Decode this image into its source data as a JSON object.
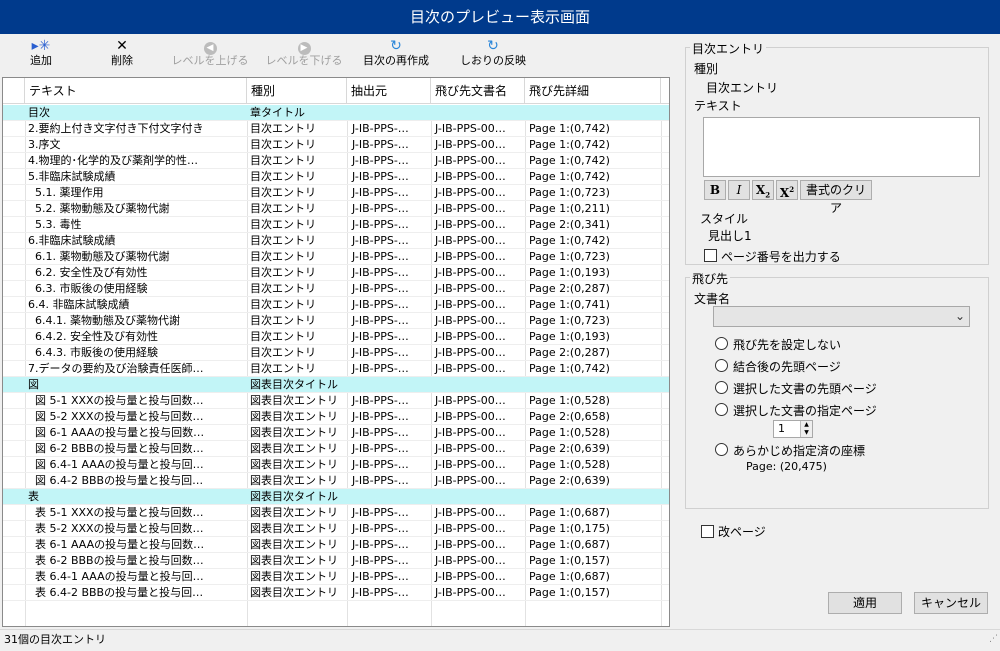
{
  "window": {
    "title": "目次のプレビュー表示画面"
  },
  "toolbar": {
    "add": "追加",
    "delete": "削除",
    "level_up": "レベルを上げる",
    "level_down": "レベルを下げる",
    "regenerate": "目次の再作成",
    "bookmark": "しおりの反映"
  },
  "grid": {
    "headers": [
      "テキスト",
      "種別",
      "抽出元",
      "飛び先文書名",
      "飛び先詳細"
    ],
    "rows": [
      [
        "目次",
        "章タイトル",
        "",
        "",
        ""
      ],
      [
        "2.要約上付き文字付き下付文字付き",
        "目次エントリ",
        "J-IB-PPS-…",
        "J-IB-PPS-00…",
        "Page 1:(0,742)"
      ],
      [
        "3.序文",
        "目次エントリ",
        "J-IB-PPS-…",
        "J-IB-PPS-00…",
        "Page 1:(0,742)"
      ],
      [
        "4.物理的･化学的及び薬剤学的性…",
        "目次エントリ",
        "J-IB-PPS-…",
        "J-IB-PPS-00…",
        "Page 1:(0,742)"
      ],
      [
        "5.非臨床試験成績",
        "目次エントリ",
        "J-IB-PPS-…",
        "J-IB-PPS-00…",
        "Page 1:(0,742)"
      ],
      [
        "  5.1. 薬理作用",
        "目次エントリ",
        "J-IB-PPS-…",
        "J-IB-PPS-00…",
        "Page 1:(0,723)"
      ],
      [
        "  5.2. 薬物動態及び薬物代謝",
        "目次エントリ",
        "J-IB-PPS-…",
        "J-IB-PPS-00…",
        "Page 1:(0,211)"
      ],
      [
        "  5.3. 毒性",
        "目次エントリ",
        "J-IB-PPS-…",
        "J-IB-PPS-00…",
        "Page 2:(0,341)"
      ],
      [
        "6.非臨床試験成績",
        "目次エントリ",
        "J-IB-PPS-…",
        "J-IB-PPS-00…",
        "Page 1:(0,742)"
      ],
      [
        "  6.1. 薬物動態及び薬物代謝",
        "目次エントリ",
        "J-IB-PPS-…",
        "J-IB-PPS-00…",
        "Page 1:(0,723)"
      ],
      [
        "  6.2. 安全性及び有効性",
        "目次エントリ",
        "J-IB-PPS-…",
        "J-IB-PPS-00…",
        "Page 1:(0,193)"
      ],
      [
        "  6.3. 市販後の使用経験",
        "目次エントリ",
        "J-IB-PPS-…",
        "J-IB-PPS-00…",
        "Page 2:(0,287)"
      ],
      [
        "6.4. 非臨床試験成績",
        "目次エントリ",
        "J-IB-PPS-…",
        "J-IB-PPS-00…",
        "Page 1:(0,741)"
      ],
      [
        "  6.4.1. 薬物動態及び薬物代謝",
        "目次エントリ",
        "J-IB-PPS-…",
        "J-IB-PPS-00…",
        "Page 1:(0,723)"
      ],
      [
        "  6.4.2. 安全性及び有効性",
        "目次エントリ",
        "J-IB-PPS-…",
        "J-IB-PPS-00…",
        "Page 1:(0,193)"
      ],
      [
        "  6.4.3. 市販後の使用経験",
        "目次エントリ",
        "J-IB-PPS-…",
        "J-IB-PPS-00…",
        "Page 2:(0,287)"
      ],
      [
        "7.データの要約及び治験責任医師…",
        "目次エントリ",
        "J-IB-PPS-…",
        "J-IB-PPS-00…",
        "Page 1:(0,742)"
      ],
      [
        "図",
        "図表目次タイトル",
        "",
        "",
        ""
      ],
      [
        "  図 5-1 XXXの投与量と投与回数…",
        "図表目次エントリ",
        "J-IB-PPS-…",
        "J-IB-PPS-00…",
        "Page 1:(0,528)"
      ],
      [
        "  図 5-2 XXXの投与量と投与回数…",
        "図表目次エントリ",
        "J-IB-PPS-…",
        "J-IB-PPS-00…",
        "Page 2:(0,658)"
      ],
      [
        "  図 6-1 AAAの投与量と投与回数…",
        "図表目次エントリ",
        "J-IB-PPS-…",
        "J-IB-PPS-00…",
        "Page 1:(0,528)"
      ],
      [
        "  図 6-2 BBBの投与量と投与回数…",
        "図表目次エントリ",
        "J-IB-PPS-…",
        "J-IB-PPS-00…",
        "Page 2:(0,639)"
      ],
      [
        "  図 6.4-1 AAAの投与量と投与回…",
        "図表目次エントリ",
        "J-IB-PPS-…",
        "J-IB-PPS-00…",
        "Page 1:(0,528)"
      ],
      [
        "  図 6.4-2 BBBの投与量と投与回…",
        "図表目次エントリ",
        "J-IB-PPS-…",
        "J-IB-PPS-00…",
        "Page 2:(0,639)"
      ],
      [
        "表",
        "図表目次タイトル",
        "",
        "",
        ""
      ],
      [
        "  表 5-1 XXXの投与量と投与回数…",
        "図表目次エントリ",
        "J-IB-PPS-…",
        "J-IB-PPS-00…",
        "Page 1:(0,687)"
      ],
      [
        "  表 5-2 XXXの投与量と投与回数…",
        "図表目次エントリ",
        "J-IB-PPS-…",
        "J-IB-PPS-00…",
        "Page 1:(0,175)"
      ],
      [
        "  表 6-1 AAAの投与量と投与回数…",
        "図表目次エントリ",
        "J-IB-PPS-…",
        "J-IB-PPS-00…",
        "Page 1:(0,687)"
      ],
      [
        "  表 6-2 BBBの投与量と投与回数…",
        "図表目次エントリ",
        "J-IB-PPS-…",
        "J-IB-PPS-00…",
        "Page 1:(0,157)"
      ],
      [
        "  表 6.4-1 AAAの投与量と投与回…",
        "図表目次エントリ",
        "J-IB-PPS-…",
        "J-IB-PPS-00…",
        "Page 1:(0,687)"
      ],
      [
        "  表 6.4-2 BBBの投与量と投与回…",
        "図表目次エントリ",
        "J-IB-PPS-…",
        "J-IB-PPS-00…",
        "Page 1:(0,157)"
      ]
    ],
    "heading_rows": [
      0,
      17,
      24
    ],
    "heading_color": "#c2f5f7"
  },
  "status": {
    "text": "31個の目次エントリ"
  },
  "entry_panel": {
    "group_title": "目次エントリ",
    "kind_label": "種別",
    "kind_value": "目次エントリ",
    "text_label": "テキスト",
    "text_value": "",
    "bold": "B",
    "italic": "I",
    "subscript": "X",
    "subscript_mark": "2",
    "superscript": "X",
    "superscript_mark": "2",
    "clear_format": "書式のクリア",
    "style_label": "スタイル",
    "style_value": "見出し1",
    "page_number_checkbox": "ページ番号を出力する",
    "page_number_checked": false
  },
  "jump_panel": {
    "group_title": "飛び先",
    "doc_label": "文書名",
    "doc_value": "",
    "options": [
      "飛び先を設定しない",
      "結合後の先頭ページ",
      "選択した文書の先頭ページ",
      "選択した文書の指定ページ",
      "あらかじめ指定済の座標"
    ],
    "page_spin_value": "1",
    "coord_text": "Page: (20,475)"
  },
  "page_break": {
    "label": "改ページ",
    "checked": false
  },
  "buttons": {
    "apply": "適用",
    "cancel": "キャンセル"
  }
}
